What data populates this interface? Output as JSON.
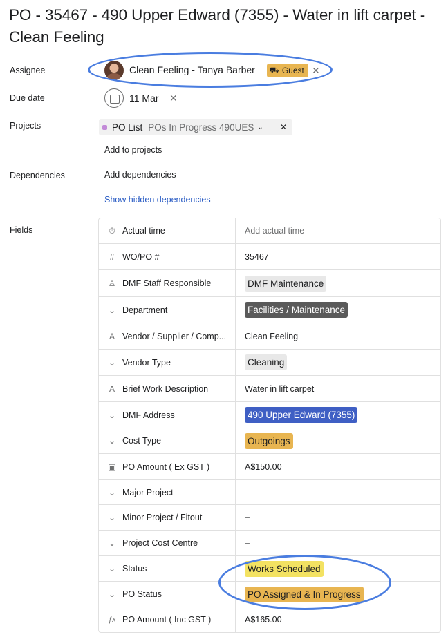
{
  "title": "PO - 35467 - 490 Upper Edward (7355) - Water in lift carpet - Clean Feeling",
  "assignee": {
    "label": "Assignee",
    "name": "Clean Feeling - Tanya Barber",
    "badge": "Guest"
  },
  "due_date": {
    "label": "Due date",
    "value": "11 Mar"
  },
  "projects": {
    "label": "Projects",
    "project_name": "PO List",
    "section": "POs In Progress 490UES",
    "add_label": "Add to projects",
    "project_color": "#c38bd8"
  },
  "dependencies": {
    "label": "Dependencies",
    "add_label": "Add dependencies",
    "show_hidden": "Show hidden dependencies"
  },
  "fields_label": "Fields",
  "fields": [
    {
      "icon": "timer-icon",
      "glyph": "⏱",
      "name": "Actual time",
      "value": "Add actual time",
      "style": "muted"
    },
    {
      "icon": "hash-icon",
      "glyph": "#",
      "name": "WO/PO #",
      "value": "35467",
      "style": "text"
    },
    {
      "icon": "person-icon",
      "glyph": "♙",
      "name": "DMF Staff Responsible",
      "value": "DMF Maintenance",
      "style": "pill",
      "bg": "#e8e8e8",
      "fg": "#1e1f21"
    },
    {
      "icon": "dropdown-icon",
      "glyph": "⌄",
      "name": "Department",
      "value": "Facilities / Maintenance",
      "style": "pill",
      "bg": "#5a5a5a",
      "fg": "#ffffff"
    },
    {
      "icon": "text-icon",
      "glyph": "A",
      "name": "Vendor / Supplier / Comp...",
      "value": "Clean Feeling",
      "style": "text"
    },
    {
      "icon": "dropdown-icon",
      "glyph": "⌄",
      "name": "Vendor Type",
      "value": "Cleaning",
      "style": "pill",
      "bg": "#e8e8e8",
      "fg": "#1e1f21"
    },
    {
      "icon": "text-icon",
      "glyph": "A",
      "name": "Brief Work Description",
      "value": "Water in lift carpet",
      "style": "text"
    },
    {
      "icon": "dropdown-icon",
      "glyph": "⌄",
      "name": "DMF Address",
      "value": "490 Upper Edward (7355)",
      "style": "pill",
      "bg": "#3f5fc4",
      "fg": "#ffffff"
    },
    {
      "icon": "dropdown-icon",
      "glyph": "⌄",
      "name": "Cost Type",
      "value": "Outgoings",
      "style": "pill",
      "bg": "#e8b551",
      "fg": "#1e1f21"
    },
    {
      "icon": "currency-icon",
      "glyph": "▣",
      "name": "PO Amount ( Ex GST )",
      "value": "A$150.00",
      "style": "text"
    },
    {
      "icon": "dropdown-icon",
      "glyph": "⌄",
      "name": "Major Project",
      "value": "–",
      "style": "muted"
    },
    {
      "icon": "dropdown-icon",
      "glyph": "⌄",
      "name": "Minor Project / Fitout",
      "value": "–",
      "style": "muted"
    },
    {
      "icon": "dropdown-icon",
      "glyph": "⌄",
      "name": "Project Cost Centre",
      "value": "–",
      "style": "muted"
    },
    {
      "icon": "dropdown-icon",
      "glyph": "⌄",
      "name": "Status",
      "value": "Works Scheduled",
      "style": "pill",
      "bg": "#f3e262",
      "fg": "#1e1f21"
    },
    {
      "icon": "dropdown-icon",
      "glyph": "⌄",
      "name": "PO Status",
      "value": "PO Assigned & In Progress",
      "style": "pill",
      "bg": "#e8b551",
      "fg": "#1e1f21"
    },
    {
      "icon": "formula-icon",
      "glyph": "ƒx",
      "name": "PO Amount ( Inc GST )",
      "value": "A$165.00",
      "style": "text"
    }
  ]
}
